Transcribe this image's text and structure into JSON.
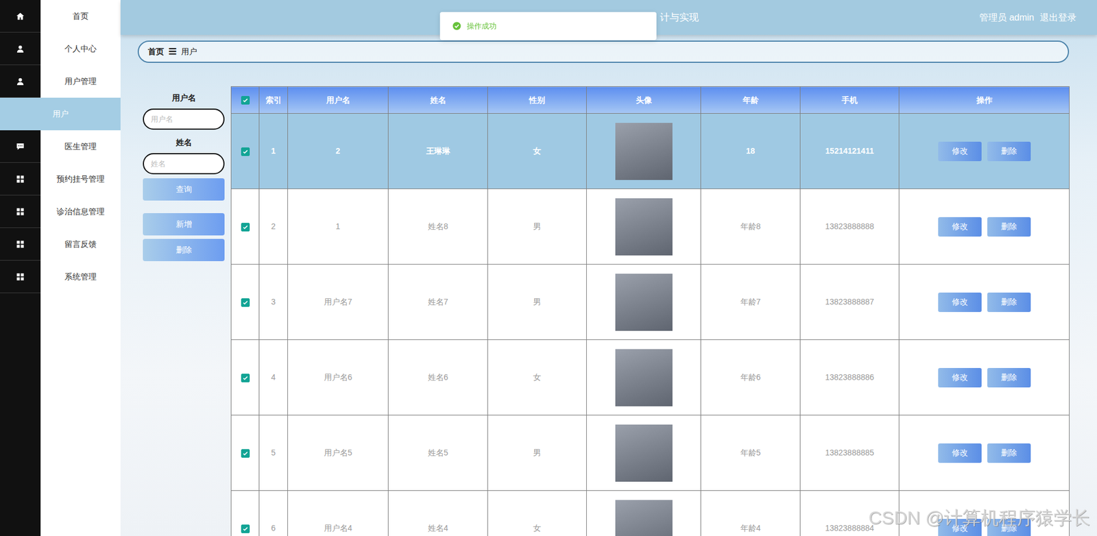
{
  "header": {
    "title": "计与实现",
    "user": "管理员 admin",
    "logout": "退出登录"
  },
  "toast": {
    "text": "操作成功"
  },
  "sidebar": {
    "items": [
      {
        "label": "首页",
        "kind": "home",
        "selected": false
      },
      {
        "label": "个人中心",
        "kind": "person",
        "selected": false
      },
      {
        "label": "用户管理",
        "kind": "person",
        "selected": false
      },
      {
        "label": "用户",
        "kind": "child",
        "selected": true
      },
      {
        "label": "医生管理",
        "kind": "message",
        "selected": false
      },
      {
        "label": "预约挂号管理",
        "kind": "module",
        "selected": false
      },
      {
        "label": "诊治信息管理",
        "kind": "module",
        "selected": false
      },
      {
        "label": "留言反馈",
        "kind": "module",
        "selected": false
      },
      {
        "label": "系统管理",
        "kind": "module",
        "selected": false
      }
    ]
  },
  "breadcrumb": {
    "items": [
      "首页",
      "用户"
    ],
    "separator": "☰"
  },
  "search": {
    "fields": [
      {
        "label": "用户名",
        "placeholder": "用户名"
      },
      {
        "label": "姓名",
        "placeholder": "姓名"
      }
    ],
    "buttons": [
      "查询",
      "新增",
      "删除"
    ]
  },
  "table": {
    "all_checked": true,
    "columns": [
      "索引",
      "用户名",
      "姓名",
      "性别",
      "头像",
      "年龄",
      "手机",
      "操作"
    ],
    "rows": [
      {
        "index": "1",
        "username": "2",
        "name": "王琳琳",
        "gender": "女",
        "age": "18",
        "phone": "15214121411",
        "checked": true,
        "selected": true,
        "actions": [
          "修改",
          "删除"
        ]
      },
      {
        "index": "2",
        "username": "1",
        "name": "姓名8",
        "gender": "男",
        "age": "年龄8",
        "phone": "13823888888",
        "checked": true,
        "selected": false,
        "actions": [
          "修改",
          "删除"
        ]
      },
      {
        "index": "3",
        "username": "用户名7",
        "name": "姓名7",
        "gender": "男",
        "age": "年龄7",
        "phone": "13823888887",
        "checked": true,
        "selected": false,
        "actions": [
          "修改",
          "删除"
        ]
      },
      {
        "index": "4",
        "username": "用户名6",
        "name": "姓名6",
        "gender": "女",
        "age": "年龄6",
        "phone": "13823888886",
        "checked": true,
        "selected": false,
        "actions": [
          "修改",
          "删除"
        ]
      },
      {
        "index": "5",
        "username": "用户名5",
        "name": "姓名5",
        "gender": "男",
        "age": "年龄5",
        "phone": "13823888885",
        "checked": true,
        "selected": false,
        "actions": [
          "修改",
          "删除"
        ]
      },
      {
        "index": "6",
        "username": "用户名4",
        "name": "姓名4",
        "gender": "女",
        "age": "年龄4",
        "phone": "13823888884",
        "checked": true,
        "selected": false,
        "actions": [
          "修改",
          "删除"
        ]
      }
    ]
  },
  "watermark": "CSDN @计算机程序猿学长"
}
